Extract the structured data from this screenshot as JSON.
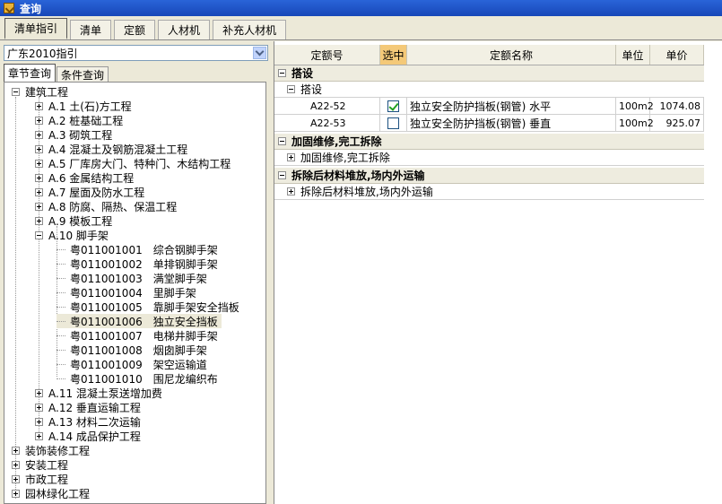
{
  "window": {
    "title": "查询"
  },
  "tabs": [
    {
      "label": "清单指引",
      "active": true
    },
    {
      "label": "清单"
    },
    {
      "label": "定额"
    },
    {
      "label": "人材机"
    },
    {
      "label": "补充人材机"
    }
  ],
  "left": {
    "combo_value": "广东2010指引",
    "subtabs": [
      "章节查询",
      "条件查询"
    ],
    "tree": {
      "root": "建筑工程",
      "chapters": [
        "A.1 土(石)方工程",
        "A.2 桩基础工程",
        "A.3 砌筑工程",
        "A.4 混凝土及钢筋混凝土工程",
        "A.5 厂库房大门、特种门、木结构工程",
        "A.6 金属结构工程",
        "A.7 屋面及防水工程",
        "A.8 防腐、隔热、保温工程",
        "A.9 模板工程",
        "A.10 脚手架"
      ],
      "a10_items": [
        {
          "code": "粤011001001",
          "name": "综合钢脚手架"
        },
        {
          "code": "粤011001002",
          "name": "单排钢脚手架"
        },
        {
          "code": "粤011001003",
          "name": "满堂脚手架"
        },
        {
          "code": "粤011001004",
          "name": "里脚手架"
        },
        {
          "code": "粤011001005",
          "name": "靠脚手架安全挡板"
        },
        {
          "code": "粤011001006",
          "name": "独立安全挡板"
        },
        {
          "code": "粤011001007",
          "name": "电梯井脚手架"
        },
        {
          "code": "粤011001008",
          "name": "烟囱脚手架"
        },
        {
          "code": "粤011001009",
          "name": "架空运输道"
        },
        {
          "code": "粤011001010",
          "name": "围尼龙编织布"
        }
      ],
      "more_chapters": [
        "A.11 混凝土泵送增加费",
        "A.12 垂直运输工程",
        "A.13 材料二次运输",
        "A.14 成品保护工程"
      ],
      "other_roots": [
        "装饰装修工程",
        "安装工程",
        "市政工程",
        "园林绿化工程"
      ]
    }
  },
  "grid": {
    "columns": [
      "定额号",
      "选中",
      "定额名称",
      "单位",
      "单价"
    ],
    "groups": [
      {
        "title": "搭设",
        "sub": "搭设",
        "rows": [
          {
            "code": "A22-52",
            "checked": true,
            "name": "独立安全防护挡板(钢管) 水平",
            "unit": "100m2",
            "price": "1074.08"
          },
          {
            "code": "A22-53",
            "checked": false,
            "name": "独立安全防护挡板(钢管) 垂直",
            "unit": "100m2",
            "price": "925.07"
          }
        ]
      },
      {
        "title": "加固维修,完工拆除",
        "sub": "加固维修,完工拆除"
      },
      {
        "title": "拆除后材料堆放,场内外运输",
        "sub": "拆除后材料堆放,场内外运输"
      }
    ]
  }
}
